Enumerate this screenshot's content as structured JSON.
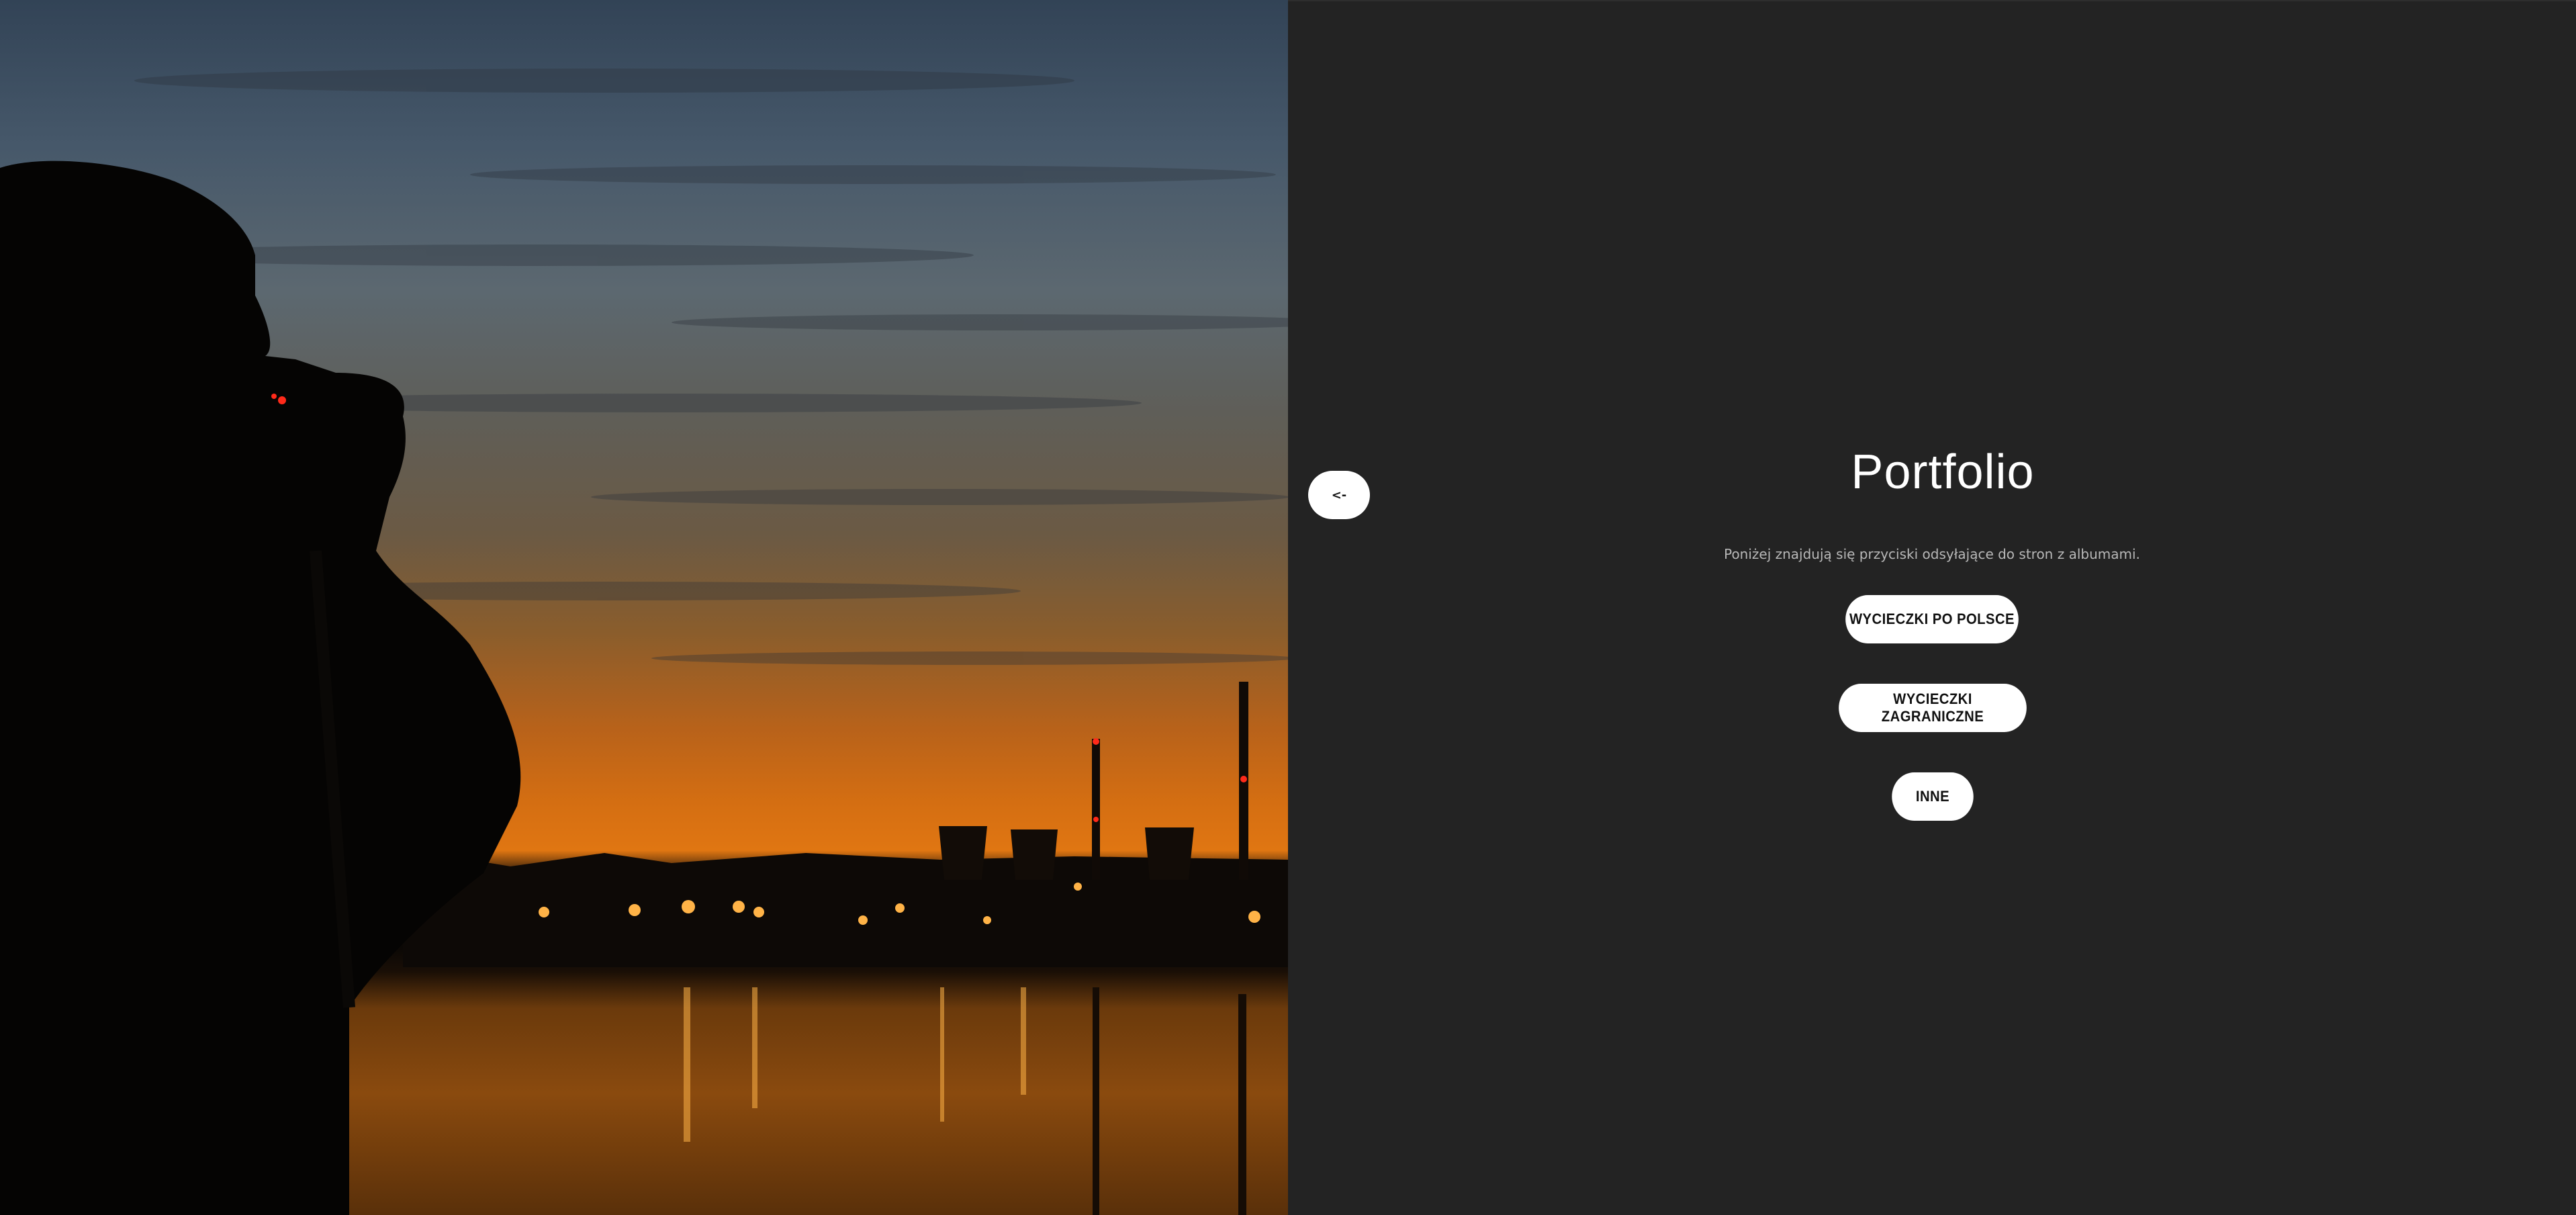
{
  "navigation": {
    "back_label": "<-"
  },
  "main": {
    "title": "Portfolio",
    "subtitle": "Poniżej znajdują się przyciski odsyłające do stron z albumami.",
    "buttons": [
      {
        "label": "WYCIECZKI PO POLSCE"
      },
      {
        "label": "WYCIECZKI ZAGRANICZNE"
      },
      {
        "label": "INNE"
      }
    ]
  },
  "colors": {
    "background": "#232323",
    "button": "#ffffff",
    "title": "#ffffff",
    "subtitle": "#b8b8b8",
    "sunset_accent": "#e07612"
  }
}
